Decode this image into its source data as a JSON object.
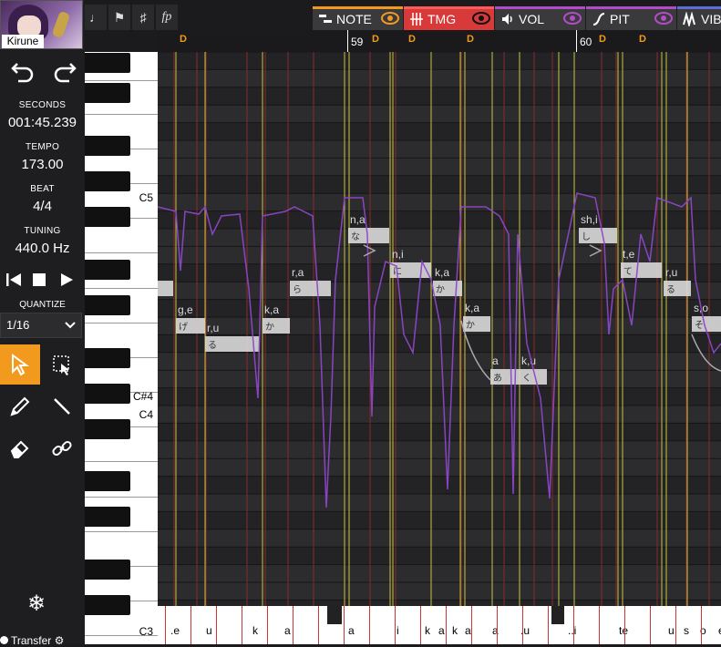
{
  "avatar": {
    "name": "Kirune"
  },
  "history": {
    "undo": "undo-icon",
    "redo": "redo-icon"
  },
  "stats": {
    "seconds_label": "SECONDS",
    "seconds_value": "001:45.239",
    "tempo_label": "TEMPO",
    "tempo_value": "173.00",
    "beat_label": "BEAT",
    "beat_value": "4/4",
    "tuning_label": "TUNING",
    "tuning_value": "440.0 Hz"
  },
  "quantize": {
    "label": "QUANTIZE",
    "value": "1/16"
  },
  "transfer": {
    "label": "Transfer"
  },
  "tabs": [
    {
      "label": "NOTE",
      "color": "#f29a1d"
    },
    {
      "label": "TMG",
      "color": "#e83a3a"
    },
    {
      "label": "VOL",
      "color": "#b24cc8"
    },
    {
      "label": "PIT",
      "color": "#b24cc8"
    },
    {
      "label": "VIB",
      "color": "#5b6fd6"
    }
  ],
  "ruler": {
    "bar_59": "59",
    "bar_60": "60",
    "marker": "D"
  },
  "keys": {
    "c5": "C5",
    "csharp4": "C#4",
    "c4": "C4",
    "c3": "C3"
  },
  "notes": [
    {
      "phon": "g,e",
      "lyric": "げ"
    },
    {
      "phon": "r,u",
      "lyric": "る"
    },
    {
      "phon": "k,a",
      "lyric": "か"
    },
    {
      "phon": "r,a",
      "lyric": "ら"
    },
    {
      "phon": "n,a",
      "lyric": "な"
    },
    {
      "phon": "n,i",
      "lyric": "に"
    },
    {
      "phon": "k,a",
      "lyric": "か"
    },
    {
      "phon": "k,a",
      "lyric": "か"
    },
    {
      "phon": "a",
      "lyric": "あ"
    },
    {
      "phon": "k,u",
      "lyric": "く"
    },
    {
      "phon": "sh,i",
      "lyric": "し"
    },
    {
      "phon": "t,e",
      "lyric": "て"
    },
    {
      "phon": "r,u",
      "lyric": "る"
    },
    {
      "phon": "s,o",
      "lyric": "そ"
    }
  ],
  "lyric_track": [
    ".e",
    "u",
    "k",
    "a",
    "a",
    "i",
    "k",
    "a",
    "k",
    "a",
    "a",
    ".u",
    "..i",
    "te",
    "u",
    "s",
    "o",
    "e"
  ],
  "colors": {
    "accent": "#f29a1d",
    "note_fill": "#d9d9d9",
    "timing_line": "#c8c43a",
    "grid_line": "#8a2a2a",
    "pitch_curve": "#8d47c9"
  }
}
